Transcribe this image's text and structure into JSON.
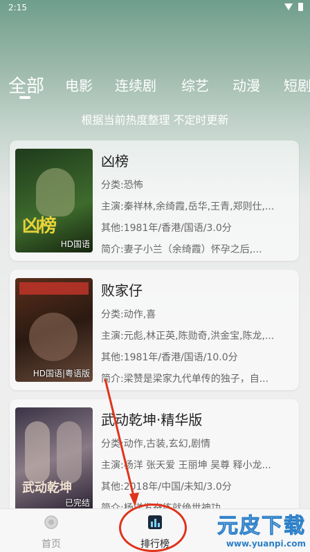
{
  "status_bar": {
    "time": "2:15"
  },
  "tabs": [
    {
      "label": "全部"
    },
    {
      "label": "电影"
    },
    {
      "label": "连续剧"
    },
    {
      "label": "综艺"
    },
    {
      "label": "动漫"
    },
    {
      "label": "短剧"
    }
  ],
  "subtitle": "根据当前热度整理 不定时更新",
  "movies": [
    {
      "title": "凶榜",
      "poster_tag": "HD国语",
      "poster_art": "凶榜",
      "poster_colors": [
        "#1f3b1c",
        "#3e6b2d"
      ],
      "genre_label": "分类:",
      "genre": "恐怖",
      "cast_label": "主演:",
      "cast": "秦祥林,余绮霞,岳华,王青,郑则仕,...",
      "other_label": "其他:",
      "other": "1981年/香港/国语/3.0分",
      "intro_label": "简介:",
      "intro": "妻子小兰（余绮霞）怀孕之后,..."
    },
    {
      "title": "败家仔",
      "poster_tag": "HD国语|粤语版",
      "poster_art": "",
      "poster_colors": [
        "#3a1e12",
        "#7a4a2a"
      ],
      "genre_label": "分类:",
      "genre": "动作,喜",
      "cast_label": "主演:",
      "cast": "元彪,林正英,陈勋奇,洪金宝,陈龙,...",
      "other_label": "其他:",
      "other": "1981年/香港/国语/10.0分",
      "intro_label": "简介:",
      "intro": "梁赞是梁家九代单传的独子，自..."
    },
    {
      "title": "武动乾坤·精华版",
      "poster_tag": "已完结",
      "poster_art": "武动乾坤",
      "poster_colors": [
        "#2e2a3a",
        "#7a6a78"
      ],
      "genre_label": "分类:",
      "genre": "动作,古装,玄幻,剧情",
      "cast_label": "主演:",
      "cast": "杨洋 张天爱 王丽坤 吴尊 释小龙...",
      "other_label": "其他:",
      "other": "2018年/中国/未知/3.0分",
      "intro_label": "简介:",
      "intro": "杨洋发奋练就绝世神功"
    }
  ],
  "bottom_nav": {
    "home_label": "首页",
    "rank_label": "排行榜"
  },
  "watermark": {
    "text": "元皮下载",
    "url": "www.yuanpi.com"
  },
  "colors": {
    "accent_ring": "#e0331a",
    "watermark_blue": "#2b7fc8"
  }
}
